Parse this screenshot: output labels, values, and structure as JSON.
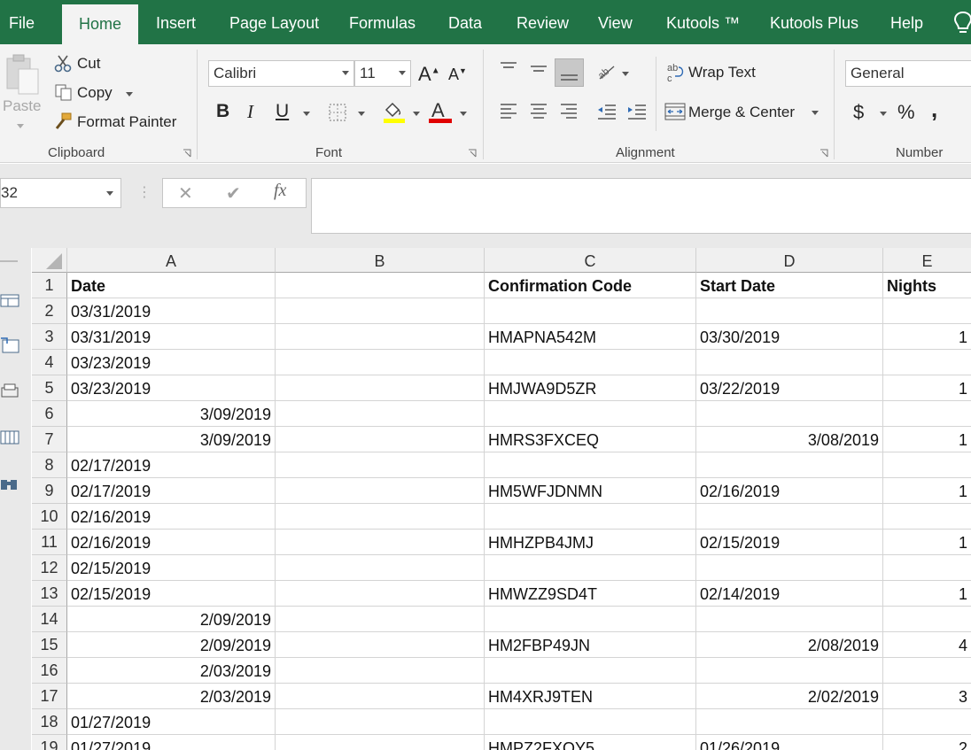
{
  "tabs": [
    "File",
    "Home",
    "Insert",
    "Page Layout",
    "Formulas",
    "Data",
    "Review",
    "View",
    "Kutools ™",
    "Kutools Plus",
    "Help"
  ],
  "active_tab": "Home",
  "ribbon": {
    "clipboard": {
      "paste": "Paste",
      "cut": "Cut",
      "copy": "Copy",
      "format_painter": "Format Painter",
      "label": "Clipboard"
    },
    "font": {
      "name": "Calibri",
      "size": "11",
      "label": "Font",
      "bold": "B",
      "italic": "I",
      "underline": "U"
    },
    "alignment": {
      "wrap_text": "Wrap Text",
      "merge_center": "Merge & Center",
      "label": "Alignment"
    },
    "number": {
      "format": "General",
      "label": "Number",
      "currency": "$",
      "percent": "%",
      "comma": ","
    }
  },
  "formula_bar": {
    "name_box": "32",
    "cancel": "✕",
    "enter": "✔",
    "fx": "fx",
    "value": ""
  },
  "colors": {
    "brand": "#217346",
    "fill_highlight": "#ffff00",
    "font_color": "#e00000"
  },
  "grid": {
    "columns": [
      "A",
      "B",
      "C",
      "D",
      "E"
    ],
    "rows": [
      {
        "n": "1",
        "A": "Date",
        "B": "",
        "C": "Confirmation Code",
        "D": "Start Date",
        "E": "Nights"
      },
      {
        "n": "2",
        "A": "03/31/2019",
        "B": "",
        "C": "",
        "D": "",
        "E": ""
      },
      {
        "n": "3",
        "A": "03/31/2019",
        "B": "",
        "C": "HMAPNA542M",
        "D": "03/30/2019",
        "E": "1"
      },
      {
        "n": "4",
        "A": "03/23/2019",
        "B": "",
        "C": "",
        "D": "",
        "E": ""
      },
      {
        "n": "5",
        "A": "03/23/2019",
        "B": "",
        "C": "HMJWA9D5ZR",
        "D": "03/22/2019",
        "E": "1"
      },
      {
        "n": "6",
        "A": "3/09/2019",
        "B": "",
        "C": "",
        "D": "",
        "E": ""
      },
      {
        "n": "7",
        "A": "3/09/2019",
        "B": "",
        "C": "HMRS3FXCEQ",
        "D": "3/08/2019",
        "E": "1"
      },
      {
        "n": "8",
        "A": "02/17/2019",
        "B": "",
        "C": "",
        "D": "",
        "E": ""
      },
      {
        "n": "9",
        "A": "02/17/2019",
        "B": "",
        "C": "HM5WFJDNMN",
        "D": "02/16/2019",
        "E": "1"
      },
      {
        "n": "10",
        "A": "02/16/2019",
        "B": "",
        "C": "",
        "D": "",
        "E": ""
      },
      {
        "n": "11",
        "A": "02/16/2019",
        "B": "",
        "C": "HMHZPB4JMJ",
        "D": "02/15/2019",
        "E": "1"
      },
      {
        "n": "12",
        "A": "02/15/2019",
        "B": "",
        "C": "",
        "D": "",
        "E": ""
      },
      {
        "n": "13",
        "A": "02/15/2019",
        "B": "",
        "C": "HMWZZ9SD4T",
        "D": "02/14/2019",
        "E": "1"
      },
      {
        "n": "14",
        "A": "2/09/2019",
        "B": "",
        "C": "",
        "D": "",
        "E": ""
      },
      {
        "n": "15",
        "A": "2/09/2019",
        "B": "",
        "C": "HM2FBP49JN",
        "D": "2/08/2019",
        "E": "4"
      },
      {
        "n": "16",
        "A": "2/03/2019",
        "B": "",
        "C": "",
        "D": "",
        "E": ""
      },
      {
        "n": "17",
        "A": "2/03/2019",
        "B": "",
        "C": "HM4XRJ9TEN",
        "D": "2/02/2019",
        "E": "3"
      },
      {
        "n": "18",
        "A": "01/27/2019",
        "B": "",
        "C": "",
        "D": "",
        "E": ""
      },
      {
        "n": "19",
        "A": "01/27/2019",
        "B": "",
        "C": "HMPZ2FXQY5",
        "D": "01/26/2019",
        "E": "2"
      }
    ]
  }
}
